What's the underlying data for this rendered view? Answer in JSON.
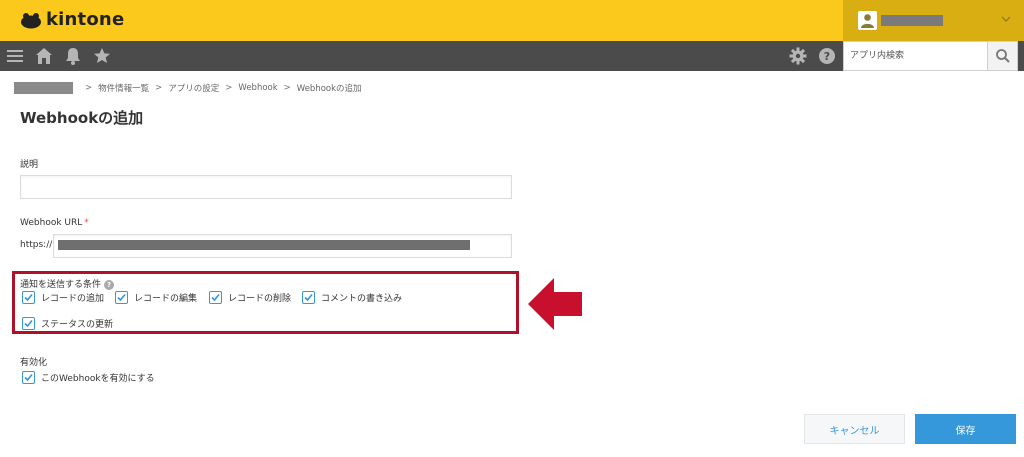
{
  "app": {
    "name": "kintone"
  },
  "search": {
    "placeholder": "アプリ内検索"
  },
  "breadcrumb": {
    "items": [
      "物件情報一覧",
      "アプリの設定",
      "Webhook",
      "Webhookの追加"
    ],
    "separator": ">"
  },
  "page": {
    "title": "Webhookの追加"
  },
  "form": {
    "description_label": "説明",
    "description_value": "",
    "url_label": "Webhook URL",
    "url_required_mark": "*",
    "url_prefix": "https://",
    "conditions_label": "通知を送信する条件",
    "conditions_help": "?",
    "conditions": [
      {
        "label": "レコードの追加",
        "checked": true
      },
      {
        "label": "レコードの編集",
        "checked": true
      },
      {
        "label": "レコードの削除",
        "checked": true
      },
      {
        "label": "コメントの書き込み",
        "checked": true
      },
      {
        "label": "ステータスの更新",
        "checked": true
      }
    ],
    "enable_label": "有効化",
    "enable_checkbox_label": "このWebhookを有効にする",
    "enable_checked": true
  },
  "buttons": {
    "cancel": "キャンセル",
    "save": "保存"
  },
  "colors": {
    "header_bg": "#fbc91c",
    "navbar_bg": "#4b4b4b",
    "accent": "#3498db",
    "highlight": "#b0112a",
    "arrow": "#c8102e"
  },
  "icons": {
    "nav": [
      "menu-icon",
      "home-icon",
      "bell-icon",
      "star-icon"
    ],
    "right": [
      "gear-icon",
      "help-icon",
      "search-icon"
    ]
  }
}
